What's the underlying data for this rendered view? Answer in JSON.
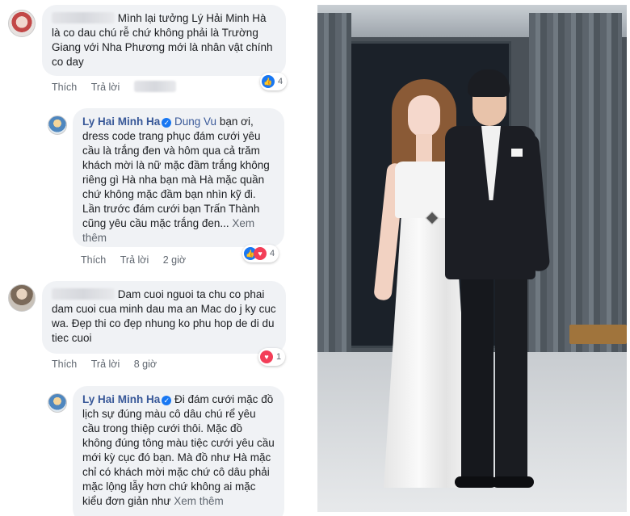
{
  "comments": [
    {
      "avatar": "avatar-icon",
      "author_blurred": "",
      "text": "Mình lại tưởng Lý Hải Minh Hà là co dau chú rễ chứ không phải là Trường Giang với Nha Phương mới là nhân vật chính co day",
      "actions": {
        "like": "Thích",
        "reply": "Trả lời"
      },
      "reactions": {
        "type": "like",
        "count": "4"
      }
    },
    {
      "avatar": "avatar-icon",
      "author": "Ly Hai Minh Ha",
      "mention": "Dung Vu",
      "text": "bạn ơi, dress code trang phục đám cưới yêu cầu là trắng đen và hôm qua cả trăm khách mời là nữ mặc đầm trắng không riêng gì Hà nha bạn mà Hà mặc quần chứ không mặc đầm bạn nhìn kỹ đi. Lần trước đám cưới bạn Trấn Thành cũng yêu cầu mặc trắng đen...",
      "see_more": "Xem thêm",
      "actions": {
        "like": "Thích",
        "reply": "Trả lời",
        "time": "2 giờ"
      },
      "reactions": {
        "type": "like-love",
        "count": "4"
      }
    },
    {
      "avatar": "avatar-icon",
      "author_blurred": "",
      "text": "Dam cuoi nguoi ta chu co phai dam cuoi cua minh dau ma an Mac do j ky cuc wa. Đẹp thi co đẹp nhung ko phu hop de di du tiec cuoi",
      "actions": {
        "like": "Thích",
        "reply": "Trả lời",
        "time": "8 giờ"
      },
      "reactions": {
        "type": "love",
        "count": "1"
      }
    },
    {
      "avatar": "avatar-icon",
      "author": "Ly Hai Minh Ha",
      "text": "Đi đám cưới mặc đồ lịch sự đúng màu cô dâu chú rể yêu cầu trong thiệp cưới thôi. Mặc đồ không đúng tông màu tiệc cưới yêu cầu mới kỳ cục đó bạn. Mà đồ như Hà mặc chỉ có khách mời mặc chứ cô dâu phải mặc lộng lẫy hơn chứ không ai mặc kiểu đơn giản như",
      "see_more": "Xem thêm"
    }
  ],
  "photo": {
    "subject": "couple-photo"
  }
}
